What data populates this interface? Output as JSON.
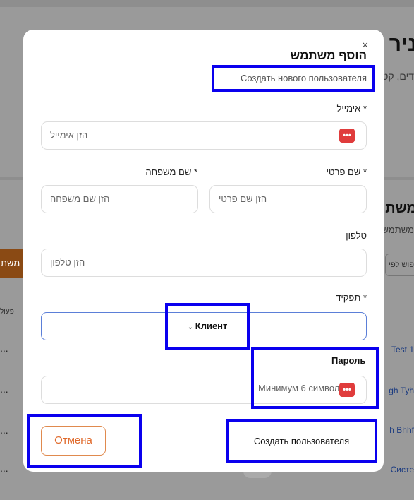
{
  "background": {
    "heading": "ניר",
    "subtitle": "דים, קט",
    "section_heading": "משתמ",
    "section_subtitle": "משתמשי",
    "orange_button": "ף משת",
    "search": "פוש לפי",
    "column": "פעול",
    "row_links": [
      "Test 1",
      "gh Tyh",
      "h Bhhf",
      "Систе"
    ],
    "row_actions": [
      "...",
      "...",
      "...",
      "..."
    ]
  },
  "modal": {
    "close": "×",
    "title": "הוסף משתמש",
    "subtitle": "Создать нового пользователя",
    "email_label": "אימייל *",
    "email_placeholder": "הזן אימייל",
    "first_name_label": "שם פרטי *",
    "first_name_placeholder": "הזן שם פרטי",
    "last_name_label": "שם משפחה *",
    "last_name_placeholder": "הזן שם משפחה",
    "phone_label": "טלפון",
    "phone_placeholder": "הזן טלפון",
    "role_label": "תפקיד *",
    "role_value": "Клиент",
    "password_label": "Пароль",
    "password_placeholder": "Минимум 6 символов",
    "password_icon": "•••",
    "cancel_label": "Отмена",
    "create_label": "Создать пользователя"
  },
  "colors": {
    "highlight_border": "#0a00ee",
    "cancel_accent": "#e0692a",
    "password_icon": "#e03c3c",
    "select_border": "#5b7fd8"
  }
}
